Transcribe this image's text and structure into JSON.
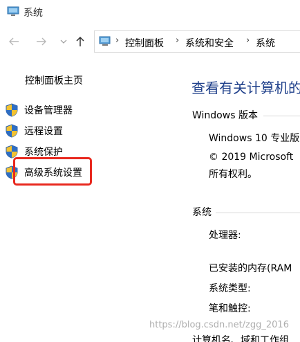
{
  "window": {
    "title": "系统",
    "icon": "system-window-icon"
  },
  "nav": {
    "back_icon": "arrow-left-icon",
    "forward_icon": "arrow-right-icon",
    "recent_icon": "chevron-down-icon",
    "up_icon": "arrow-up-icon",
    "breadcrumb": [
      "控制面板",
      "系统和安全",
      "系统"
    ],
    "separator": "›"
  },
  "sidebar": {
    "home": "控制面板主页",
    "items": [
      {
        "label": "设备管理器",
        "icon": "uac-shield-icon"
      },
      {
        "label": "远程设置",
        "icon": "uac-shield-icon"
      },
      {
        "label": "系统保护",
        "icon": "uac-shield-icon"
      },
      {
        "label": "高级系统设置",
        "icon": "uac-shield-icon",
        "highlighted": true
      }
    ],
    "highlight_color": "#e8281e"
  },
  "main": {
    "title": "查看有关计算机的",
    "windows_edition": {
      "heading": "Windows 版本",
      "edition": "Windows 10 专业版",
      "copyright": "© 2019 Microsoft",
      "rights": "所有权利。"
    },
    "system": {
      "heading": "系统",
      "processor_label": "处理器:",
      "ram_label": "已安装的内存(RAM",
      "type_label": "系统类型:",
      "pen_label": "笔和触控:"
    },
    "computer_name_partial": "计算机名、域和工作组"
  },
  "watermark": "https://blog.csdn.net/zgg_2016",
  "colors": {
    "title_blue": "#1e3f8a",
    "text": "#000000",
    "rule": "#d8d8d8"
  }
}
